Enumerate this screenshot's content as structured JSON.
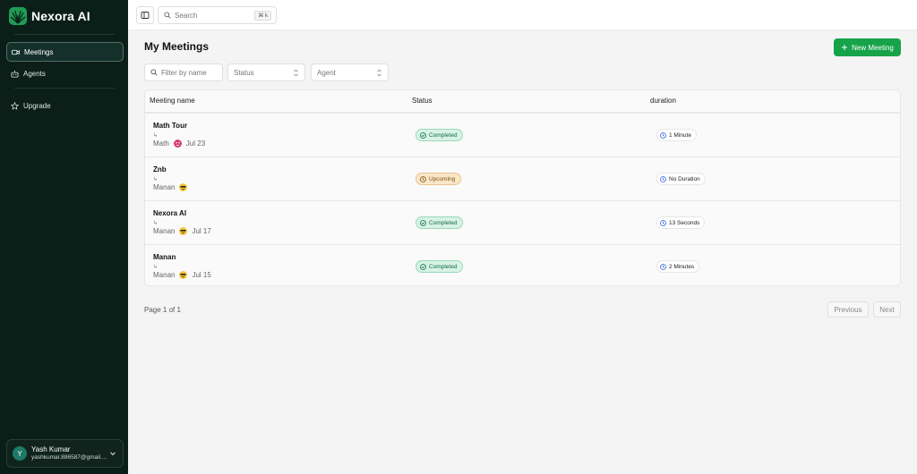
{
  "app": {
    "name": "Nexora AI"
  },
  "sidebar": {
    "items": [
      {
        "label": "Meetings",
        "icon": "video-icon",
        "active": true
      },
      {
        "label": "Agents",
        "icon": "bot-icon",
        "active": false
      }
    ],
    "upgrade_label": "Upgrade",
    "user": {
      "initial": "Y",
      "name": "Yash Kumar",
      "email": "yashkumar.886587@gmail...."
    }
  },
  "topbar": {
    "search_placeholder": "Search",
    "shortcut": "⌘ k"
  },
  "page": {
    "title": "My Meetings",
    "new_button_label": "New Meeting"
  },
  "filters": {
    "name_placeholder": "Filter by name",
    "status_label": "Status",
    "agent_label": "Agent"
  },
  "table": {
    "columns": [
      "Meeting name",
      "Status",
      "duration"
    ],
    "rows": [
      {
        "name": "Math Tour",
        "arrow": "↳",
        "agent": "Math",
        "agent_avatar": "pink-face-avatar",
        "date": "Jul 23",
        "status": "Completed",
        "duration": "1 Minute"
      },
      {
        "name": "Znb",
        "arrow": "↳",
        "agent": "Manan",
        "agent_avatar": "sunglasses-face-avatar",
        "date": "",
        "status": "Upcoming",
        "duration": "No Duration"
      },
      {
        "name": "Nexora AI",
        "arrow": "↳",
        "agent": "Manan",
        "agent_avatar": "sunglasses-face-avatar",
        "date": "Jul 17",
        "status": "Completed",
        "duration": "13 Seconds"
      },
      {
        "name": "Manan",
        "arrow": "↳",
        "agent": "Manan",
        "agent_avatar": "sunglasses-face-avatar",
        "date": "Jul 15",
        "status": "Completed",
        "duration": "2 Minutes"
      }
    ]
  },
  "pagination": {
    "info": "Page 1 of 1",
    "previous": "Previous",
    "next": "Next"
  },
  "colors": {
    "sidebar_bg": "#0b1e17",
    "accent": "#16a34a",
    "completed": "#0f6a46",
    "upcoming": "#7a4f12"
  }
}
